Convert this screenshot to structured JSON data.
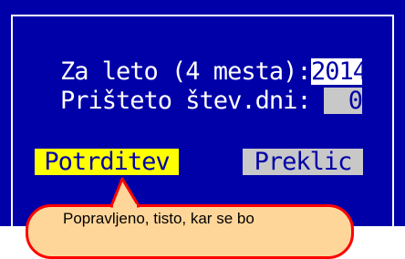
{
  "dialog": {
    "year_label": "Za leto (4 mesta):",
    "year_value": "2014",
    "days_label": "Prišteto štev.dni:",
    "days_value": "0"
  },
  "buttons": {
    "confirm_label": "Potrditev",
    "cancel_label": "Preklic"
  },
  "callout": {
    "text": "Popravljeno, tisto, kar se bo"
  },
  "colors": {
    "background": "#0000a8",
    "confirm_button": "#ffff00",
    "cancel_button": "#c8c8c8",
    "callout_fill": "#ffd699",
    "callout_border": "#ff0000"
  }
}
